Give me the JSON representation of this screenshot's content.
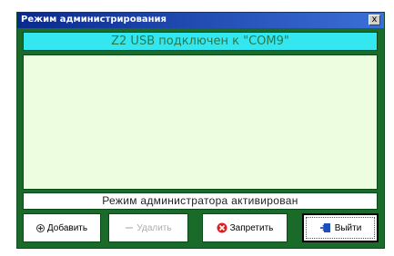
{
  "window": {
    "title": "Режим администрирования",
    "close_label": "x"
  },
  "status_top": "Z2 USB подключен к \"COM9\"",
  "status_bottom": "Режим администратора активирован",
  "buttons": {
    "add": "Добавить",
    "delete": "Удалить",
    "forbid": "Запретить",
    "exit": "Выйти"
  },
  "colors": {
    "panel": "#1a6b2a",
    "status_top_bg": "#33e6f0",
    "log_bg": "#ecfde0"
  },
  "icons": {
    "add": "plus-circle-icon",
    "delete": "minus-icon",
    "forbid": "prohibit-icon",
    "exit": "exit-door-icon"
  }
}
